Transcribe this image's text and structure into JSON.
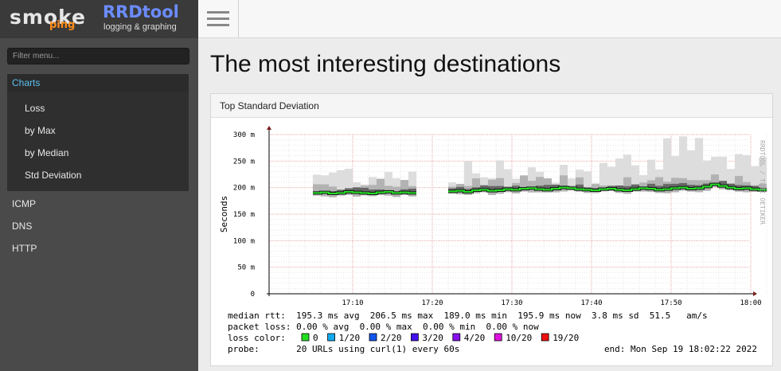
{
  "logo": {
    "smoke": "smoke",
    "ping": "ping",
    "rrdtool": "RRDtool",
    "rrdtool_sub": "logging & graphing"
  },
  "sidebar": {
    "filter_placeholder": "Filter menu...",
    "charts_label": "Charts",
    "chart_items": [
      "Loss",
      "by Max",
      "by Median",
      "Std Deviation"
    ],
    "items": [
      "ICMP",
      "DNS",
      "HTTP"
    ]
  },
  "page_title": "The most interesting destinations",
  "panel": {
    "title": "Top Standard Deviation",
    "side_label": "RRDTOOL / TOBI OETIKER",
    "legend": {
      "median_rtt": "median rtt:  195.3 ms avg  206.5 ms max  189.0 ms min  195.9 ms now  3.8 ms sd  51.5   am/s",
      "packet_loss": "packet loss: 0.00 % avg  0.00 % max  0.00 % min  0.00 % now",
      "loss_color_label": "loss color:",
      "loss_colors": [
        {
          "label": "0",
          "color": "#22dd22"
        },
        {
          "label": "1/20",
          "color": "#11aaee"
        },
        {
          "label": "2/20",
          "color": "#1155ee"
        },
        {
          "label": "3/20",
          "color": "#4411ee"
        },
        {
          "label": "4/20",
          "color": "#8811ee"
        },
        {
          "label": "10/20",
          "color": "#dd11dd"
        },
        {
          "label": "19/20",
          "color": "#ee1111"
        }
      ],
      "probe": "probe:       20 URLs using curl(1) every 60s",
      "end": "end: Mon Sep 19 18:02:22 2022"
    }
  },
  "chart_data": {
    "type": "area",
    "ylabel": "Seconds",
    "y_ticks": [
      "0",
      "50 m",
      "100 m",
      "150 m",
      "200 m",
      "250 m",
      "300 m"
    ],
    "x_ticks": [
      "17:10",
      "17:20",
      "17:30",
      "17:40",
      "17:50",
      "18:00"
    ],
    "ylim": [
      0,
      0.3
    ],
    "grid": true,
    "series": [
      {
        "name": "median",
        "segments": [
          {
            "time": [
              "17:05",
              "17:18"
            ],
            "values": [
              0.19,
              0.191,
              0.189,
              0.19,
              0.192,
              0.191,
              0.19,
              0.189,
              0.191,
              0.192,
              0.19,
              0.191,
              0.19
            ]
          },
          {
            "time": [
              "17:22",
              "18:01"
            ],
            "values": [
              0.193,
              0.194,
              0.192,
              0.195,
              0.196,
              0.194,
              0.195,
              0.197,
              0.196,
              0.198,
              0.199,
              0.197,
              0.196,
              0.198,
              0.2,
              0.199,
              0.197,
              0.196,
              0.195,
              0.197,
              0.198,
              0.196,
              0.195,
              0.197,
              0.199,
              0.198,
              0.196,
              0.197,
              0.199,
              0.2,
              0.198,
              0.199,
              0.202,
              0.206,
              0.203,
              0.2,
              0.198,
              0.199,
              0.197,
              0.196
            ]
          }
        ]
      }
    ]
  }
}
